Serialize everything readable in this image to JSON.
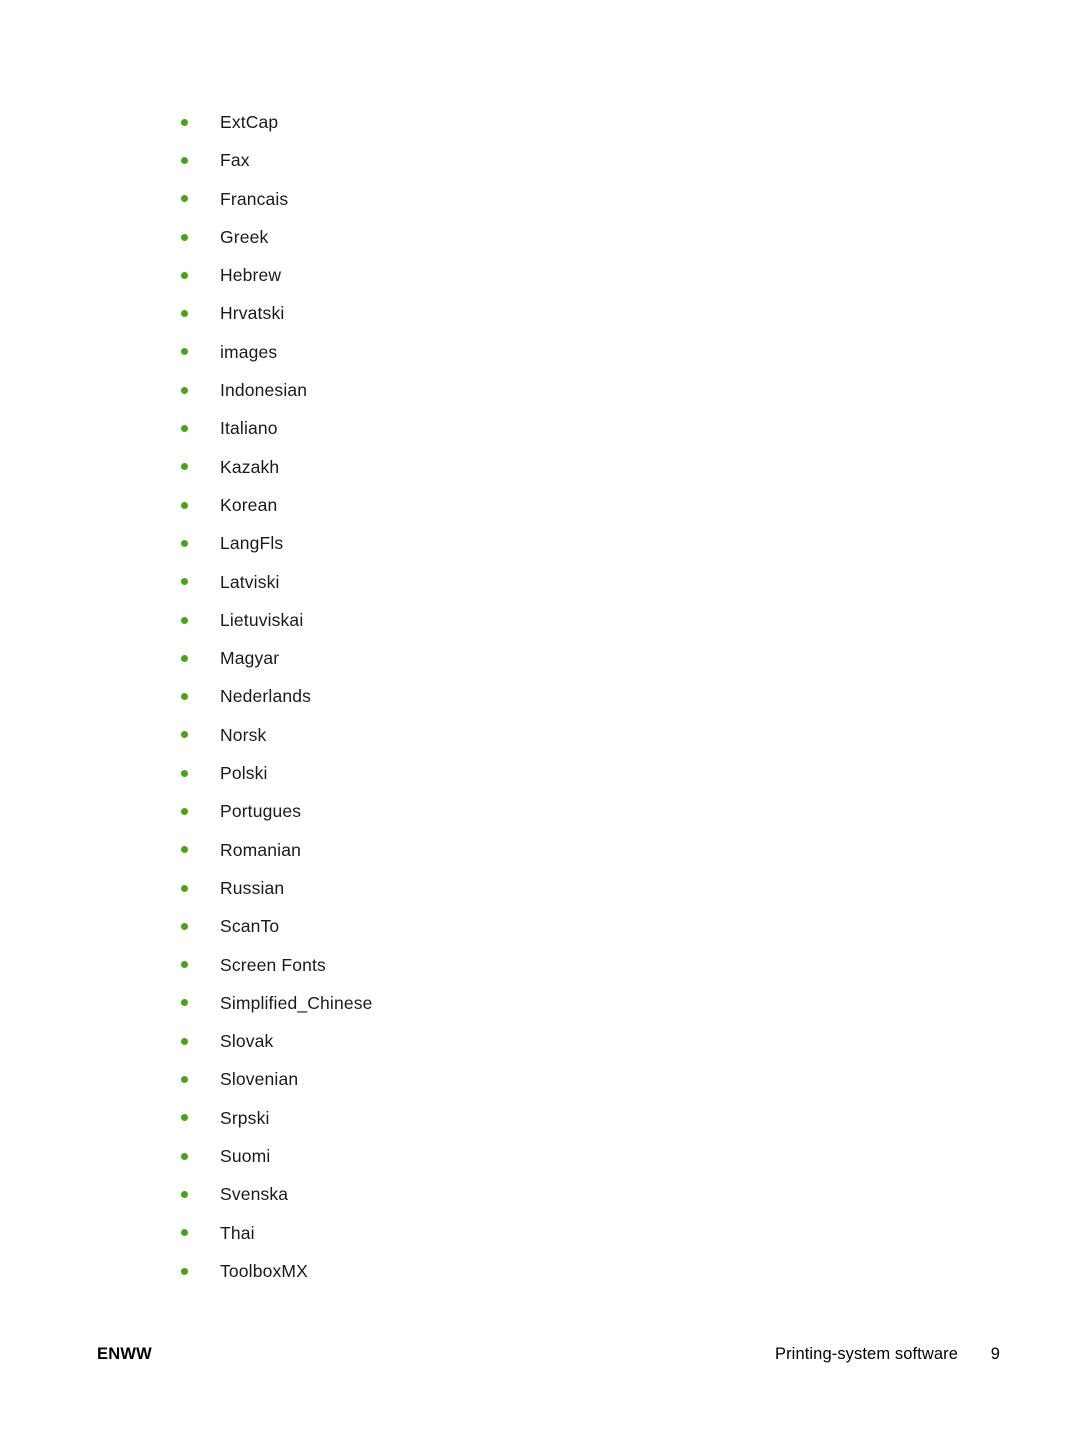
{
  "document": {
    "page_background": "#ffffff",
    "text_color": "#1a1a1a",
    "bullet_color": "#4CA01E"
  },
  "list": {
    "bullet_glyph": "bullet-dot",
    "items": [
      {
        "label": "ExtCap"
      },
      {
        "label": "Fax"
      },
      {
        "label": "Francais"
      },
      {
        "label": "Greek"
      },
      {
        "label": "Hebrew"
      },
      {
        "label": "Hrvatski"
      },
      {
        "label": "images"
      },
      {
        "label": "Indonesian"
      },
      {
        "label": "Italiano"
      },
      {
        "label": "Kazakh"
      },
      {
        "label": "Korean"
      },
      {
        "label": "LangFls"
      },
      {
        "label": "Latviski"
      },
      {
        "label": "Lietuviskai"
      },
      {
        "label": "Magyar"
      },
      {
        "label": "Nederlands"
      },
      {
        "label": "Norsk"
      },
      {
        "label": "Polski"
      },
      {
        "label": "Portugues"
      },
      {
        "label": "Romanian"
      },
      {
        "label": "Russian"
      },
      {
        "label": "ScanTo"
      },
      {
        "label": "Screen Fonts"
      },
      {
        "label": "Simplified_Chinese"
      },
      {
        "label": "Slovak"
      },
      {
        "label": "Slovenian"
      },
      {
        "label": "Srpski"
      },
      {
        "label": "Suomi"
      },
      {
        "label": "Svenska"
      },
      {
        "label": "Thai"
      },
      {
        "label": "ToolboxMX"
      }
    ]
  },
  "footer": {
    "left_label": "ENWW",
    "section_title": "Printing-system software",
    "page_number": "9"
  }
}
